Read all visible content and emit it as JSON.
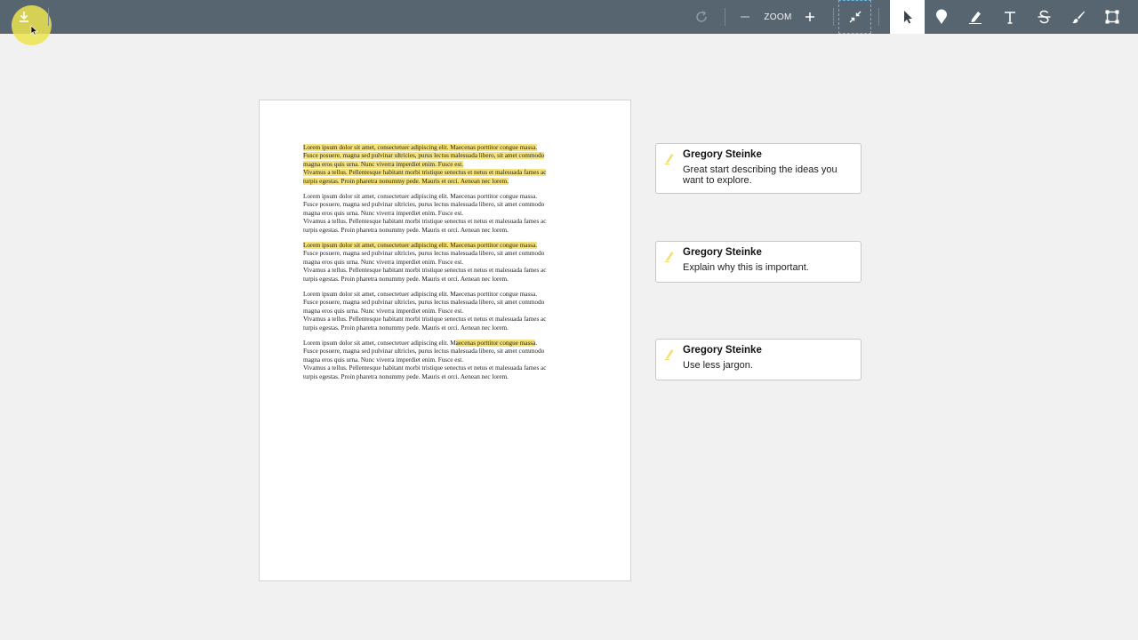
{
  "toolbar": {
    "zoom_label": "ZOOM",
    "icons": {
      "download": "download-icon",
      "rotate": "rotate-icon",
      "zoom_out": "minus-icon",
      "zoom_in": "plus-icon",
      "fit": "collapse-arrows-icon",
      "select": "cursor-arrow-icon",
      "pin": "pin-icon",
      "highlight": "pen-icon",
      "text": "text-icon",
      "strike": "strikethrough-icon",
      "brush": "brush-icon",
      "area": "area-select-icon"
    }
  },
  "document": {
    "paragraphs": [
      {
        "lines": [
          {
            "pre": "",
            "hl": "Lorem ipsum dolor sit amet, consectetuer adipiscing elit. Maecenas porttitor congue massa.",
            "post": ""
          },
          {
            "pre": "",
            "hl": "Fusce posuere, magna sed pulvinar ultricies, purus lectus malesuada libero, sit amet commodo",
            "post": ""
          },
          {
            "pre": "",
            "hl": "magna eros quis urna. Nunc viverra imperdiet enim. Fusce est.",
            "post": ""
          },
          {
            "pre": "",
            "hl": "Vivamus a tellus. Pellentesque habitant morbi tristique senectus et netus et malesuada fames ac",
            "post": ""
          },
          {
            "pre": "",
            "hl": "turpis egestas. Proin pharetra nonummy pede. Mauris et orci. Aenean nec lorem.",
            "post": ""
          }
        ]
      },
      {
        "lines": [
          {
            "pre": "Lorem ipsum dolor sit amet, consectetuer adipiscing elit. Maecenas porttitor congue massa.",
            "hl": "",
            "post": ""
          },
          {
            "pre": "Fusce posuere, magna sed pulvinar ultricies, purus lectus malesuada libero, sit amet commodo",
            "hl": "",
            "post": ""
          },
          {
            "pre": "magna eros quis urna. Nunc viverra imperdiet enim. Fusce est.",
            "hl": "",
            "post": ""
          },
          {
            "pre": "Vivamus a tellus. Pellentesque habitant morbi tristique senectus et netus et malesuada fames ac",
            "hl": "",
            "post": ""
          },
          {
            "pre": "turpis egestas. Proin pharetra nonummy pede. Mauris et orci. Aenean nec lorem.",
            "hl": "",
            "post": ""
          }
        ]
      },
      {
        "lines": [
          {
            "pre": "",
            "hl": "Lorem ipsum dolor sit amet, consectetuer adipiscing elit. Maecenas porttitor congue massa.",
            "post": ""
          },
          {
            "pre": "Fusce posuere, magna sed pulvinar ultricies, purus lectus malesuada libero, sit amet commodo",
            "hl": "",
            "post": ""
          },
          {
            "pre": "magna eros quis urna. Nunc viverra imperdiet enim. Fusce est.",
            "hl": "",
            "post": ""
          },
          {
            "pre": "Vivamus a tellus. Pellentesque habitant morbi tristique senectus et netus et malesuada fames ac",
            "hl": "",
            "post": ""
          },
          {
            "pre": "turpis egestas. Proin pharetra nonummy pede. Mauris et orci. Aenean nec lorem.",
            "hl": "",
            "post": ""
          }
        ]
      },
      {
        "lines": [
          {
            "pre": "Lorem ipsum dolor sit amet, consectetuer adipiscing elit. Maecenas porttitor congue massa.",
            "hl": "",
            "post": ""
          },
          {
            "pre": "Fusce posuere, magna sed pulvinar ultricies, purus lectus malesuada libero, sit amet commodo",
            "hl": "",
            "post": ""
          },
          {
            "pre": "magna eros quis urna. Nunc viverra imperdiet enim. Fusce est.",
            "hl": "",
            "post": ""
          },
          {
            "pre": "Vivamus a tellus. Pellentesque habitant morbi tristique senectus et netus et malesuada fames ac",
            "hl": "",
            "post": ""
          },
          {
            "pre": "turpis egestas. Proin pharetra nonummy pede. Mauris et orci. Aenean nec lorem.",
            "hl": "",
            "post": ""
          }
        ]
      },
      {
        "lines": [
          {
            "pre": "Lorem ipsum dolor sit amet, consectetuer adipiscing elit. M",
            "hl": "aecenas porttitor congue massa",
            "post": "."
          },
          {
            "pre": "Fusce posuere, magna sed pulvinar ultricies, purus lectus malesuada libero, sit amet commodo",
            "hl": "",
            "post": ""
          },
          {
            "pre": "magna eros quis urna. Nunc viverra imperdiet enim. Fusce est.",
            "hl": "",
            "post": ""
          },
          {
            "pre": "Vivamus a tellus. Pellentesque habitant morbi tristique senectus et netus et malesuada fames ac",
            "hl": "",
            "post": ""
          },
          {
            "pre": "turpis egestas. Proin pharetra nonummy pede. Mauris et orci. Aenean nec lorem.",
            "hl": "",
            "post": ""
          }
        ]
      }
    ]
  },
  "comments": [
    {
      "author": "Gregory Steinke",
      "text": "Great start describing the ideas you want to explore."
    },
    {
      "author": "Gregory Steinke",
      "text": "Explain why this is important."
    },
    {
      "author": "Gregory Steinke",
      "text": "Use less jargon."
    }
  ],
  "colors": {
    "toolbar": "#576570",
    "highlight": "#f6e27a",
    "download_halo": "#ece450",
    "active_tool": "#ffffff"
  }
}
